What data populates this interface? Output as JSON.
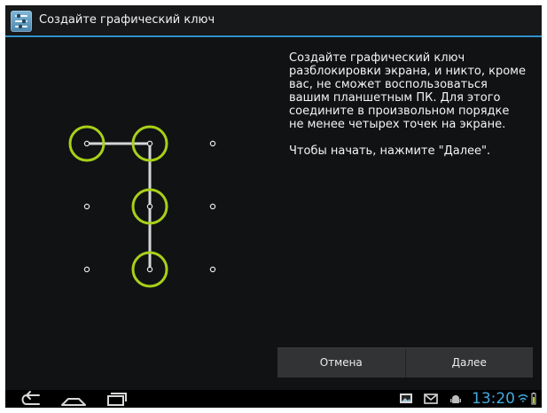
{
  "action_bar": {
    "title": "Создайте графический ключ",
    "icon": "settings-icon"
  },
  "instructions": {
    "paragraph_1": "Создайте графический ключ разблокировки экрана, и никто, кроме вас, не сможет воспользоваться вашим планшетным ПК. Для этого соедините в произвольном порядке не менее четырех точек на экране.",
    "paragraph_2": "Чтобы начать, нажмите \"Далее\"."
  },
  "pattern": {
    "grid_size": 3,
    "selected_points": [
      [
        0,
        0
      ],
      [
        0,
        1
      ],
      [
        1,
        1
      ],
      [
        2,
        1
      ]
    ],
    "highlight_color": "#a8d018",
    "line_color": "#d4d6d8"
  },
  "buttons": {
    "cancel_label": "Отмена",
    "next_label": "Далее"
  },
  "system_bar": {
    "nav_icons": [
      "back-icon",
      "home-icon",
      "recent-apps-icon"
    ],
    "status_icons": [
      "gallery-notification-icon",
      "gmail-notification-icon",
      "android-notification-icon",
      "wifi-icon",
      "battery-icon"
    ],
    "time": "13:20",
    "time_color": "#43a9dd"
  }
}
